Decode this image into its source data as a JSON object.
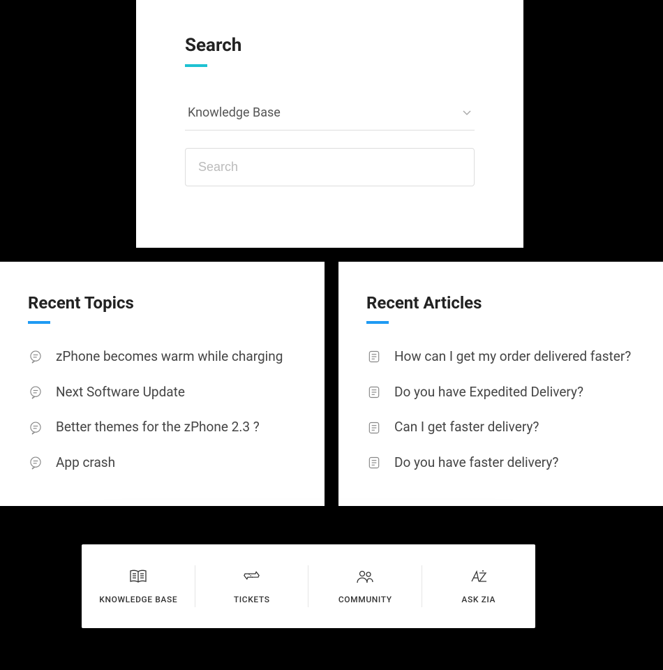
{
  "search": {
    "title": "Search",
    "select_label": "Knowledge Base",
    "placeholder": "Search"
  },
  "recent_topics": {
    "title": "Recent Topics",
    "items": [
      "zPhone becomes warm while charging",
      "Next Software Update",
      "Better themes for the zPhone 2.3 ?",
      "App crash"
    ]
  },
  "recent_articles": {
    "title": "Recent Articles",
    "items": [
      "How can I get my order delivered faster?",
      "Do you have Expedited Delivery?",
      "Can I get faster delivery?",
      "Do you have faster delivery?"
    ]
  },
  "nav": {
    "items": [
      {
        "label": "KNOWLEDGE BASE"
      },
      {
        "label": "TICKETS"
      },
      {
        "label": "COMMUNITY"
      },
      {
        "label": "ASK ZIA"
      }
    ]
  }
}
